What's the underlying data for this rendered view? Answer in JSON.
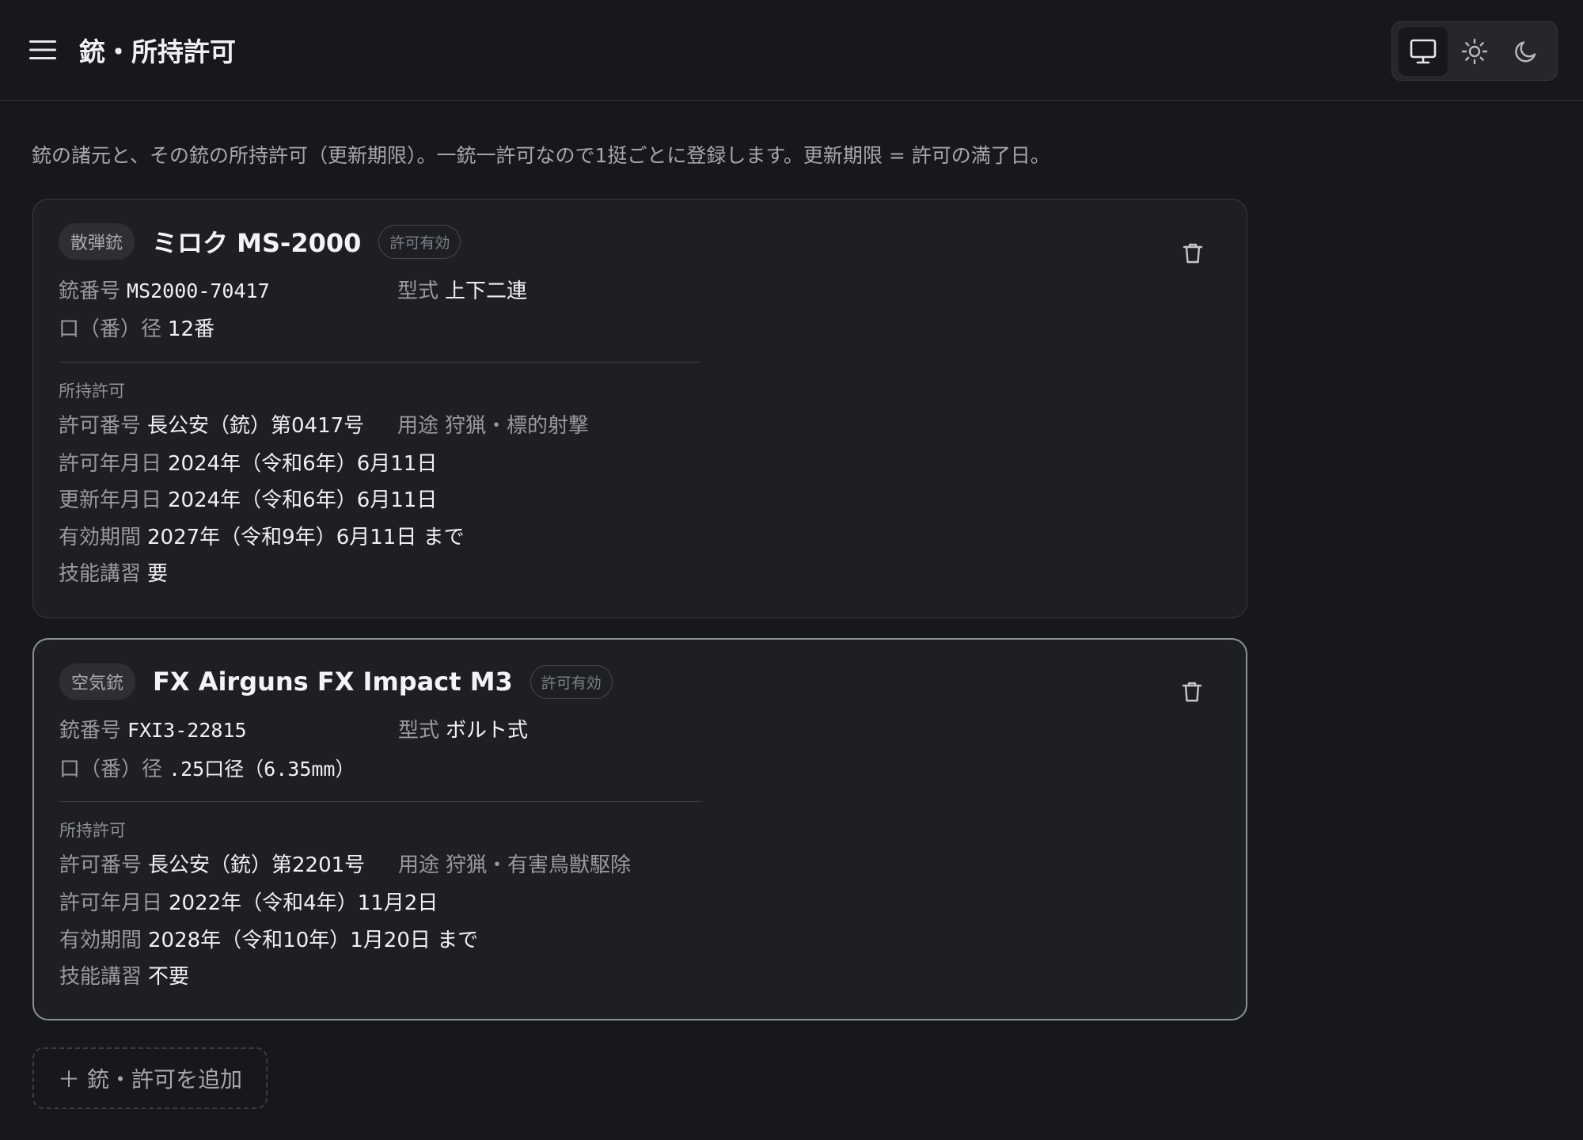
{
  "header": {
    "title": "銃・所持許可",
    "menu_icon": "hamburger-menu-icon",
    "theme_icons": [
      "monitor-icon",
      "sun-icon",
      "moon-icon"
    ]
  },
  "intro": "銃の諸元と、その銃の所持許可（更新期限）。一銃一許可なので1挺ごとに登録します。更新期限 = 許可の満了日。",
  "cards": [
    {
      "type": "散弾銃",
      "name": "ミロク MS-2000",
      "status": "許可有効",
      "serial_label": "銃番号",
      "serial": "MS2000-70417",
      "action_label": "型式",
      "action": "上下二連",
      "caliber_label": "口（番）径",
      "caliber": "12番",
      "section": "所持許可",
      "permit_no_label": "許可番号",
      "permit_no": "長公安（銃）第0417号",
      "purpose_label": "用途",
      "purpose": "狩猟・標的射撃",
      "issued_label": "許可年月日",
      "issued": "2024年（令和6年）6月11日",
      "renewed_label": "更新年月日",
      "renewed": "2024年（令和6年）6月11日",
      "valid_label": "有効期間",
      "valid": "2027年（令和9年）6月11日 まで",
      "training_label": "技能講習",
      "training": "要"
    },
    {
      "type": "空気銃",
      "name": "FX Airguns FX Impact M3",
      "status": "許可有効",
      "serial_label": "銃番号",
      "serial": "FXI3-22815",
      "action_label": "型式",
      "action": "ボルト式",
      "caliber_label": "口（番）径",
      "caliber": ".25口径（6.35mm）",
      "section": "所持許可",
      "permit_no_label": "許可番号",
      "permit_no": "長公安（銃）第2201号",
      "purpose_label": "用途",
      "purpose": "狩猟・有害鳥獣駆除",
      "issued_label": "許可年月日",
      "issued": "2022年（令和4年）11月2日",
      "valid_label": "有効期間",
      "valid": "2028年（令和10年）1月20日 まで",
      "training_label": "技能講習",
      "training": "不要"
    }
  ],
  "add_button": "＋ 銃・許可を追加",
  "colors": {
    "background": "#17181c",
    "card": "#1e1f24",
    "text": "#f0f1f3",
    "muted": "#989aa0"
  }
}
